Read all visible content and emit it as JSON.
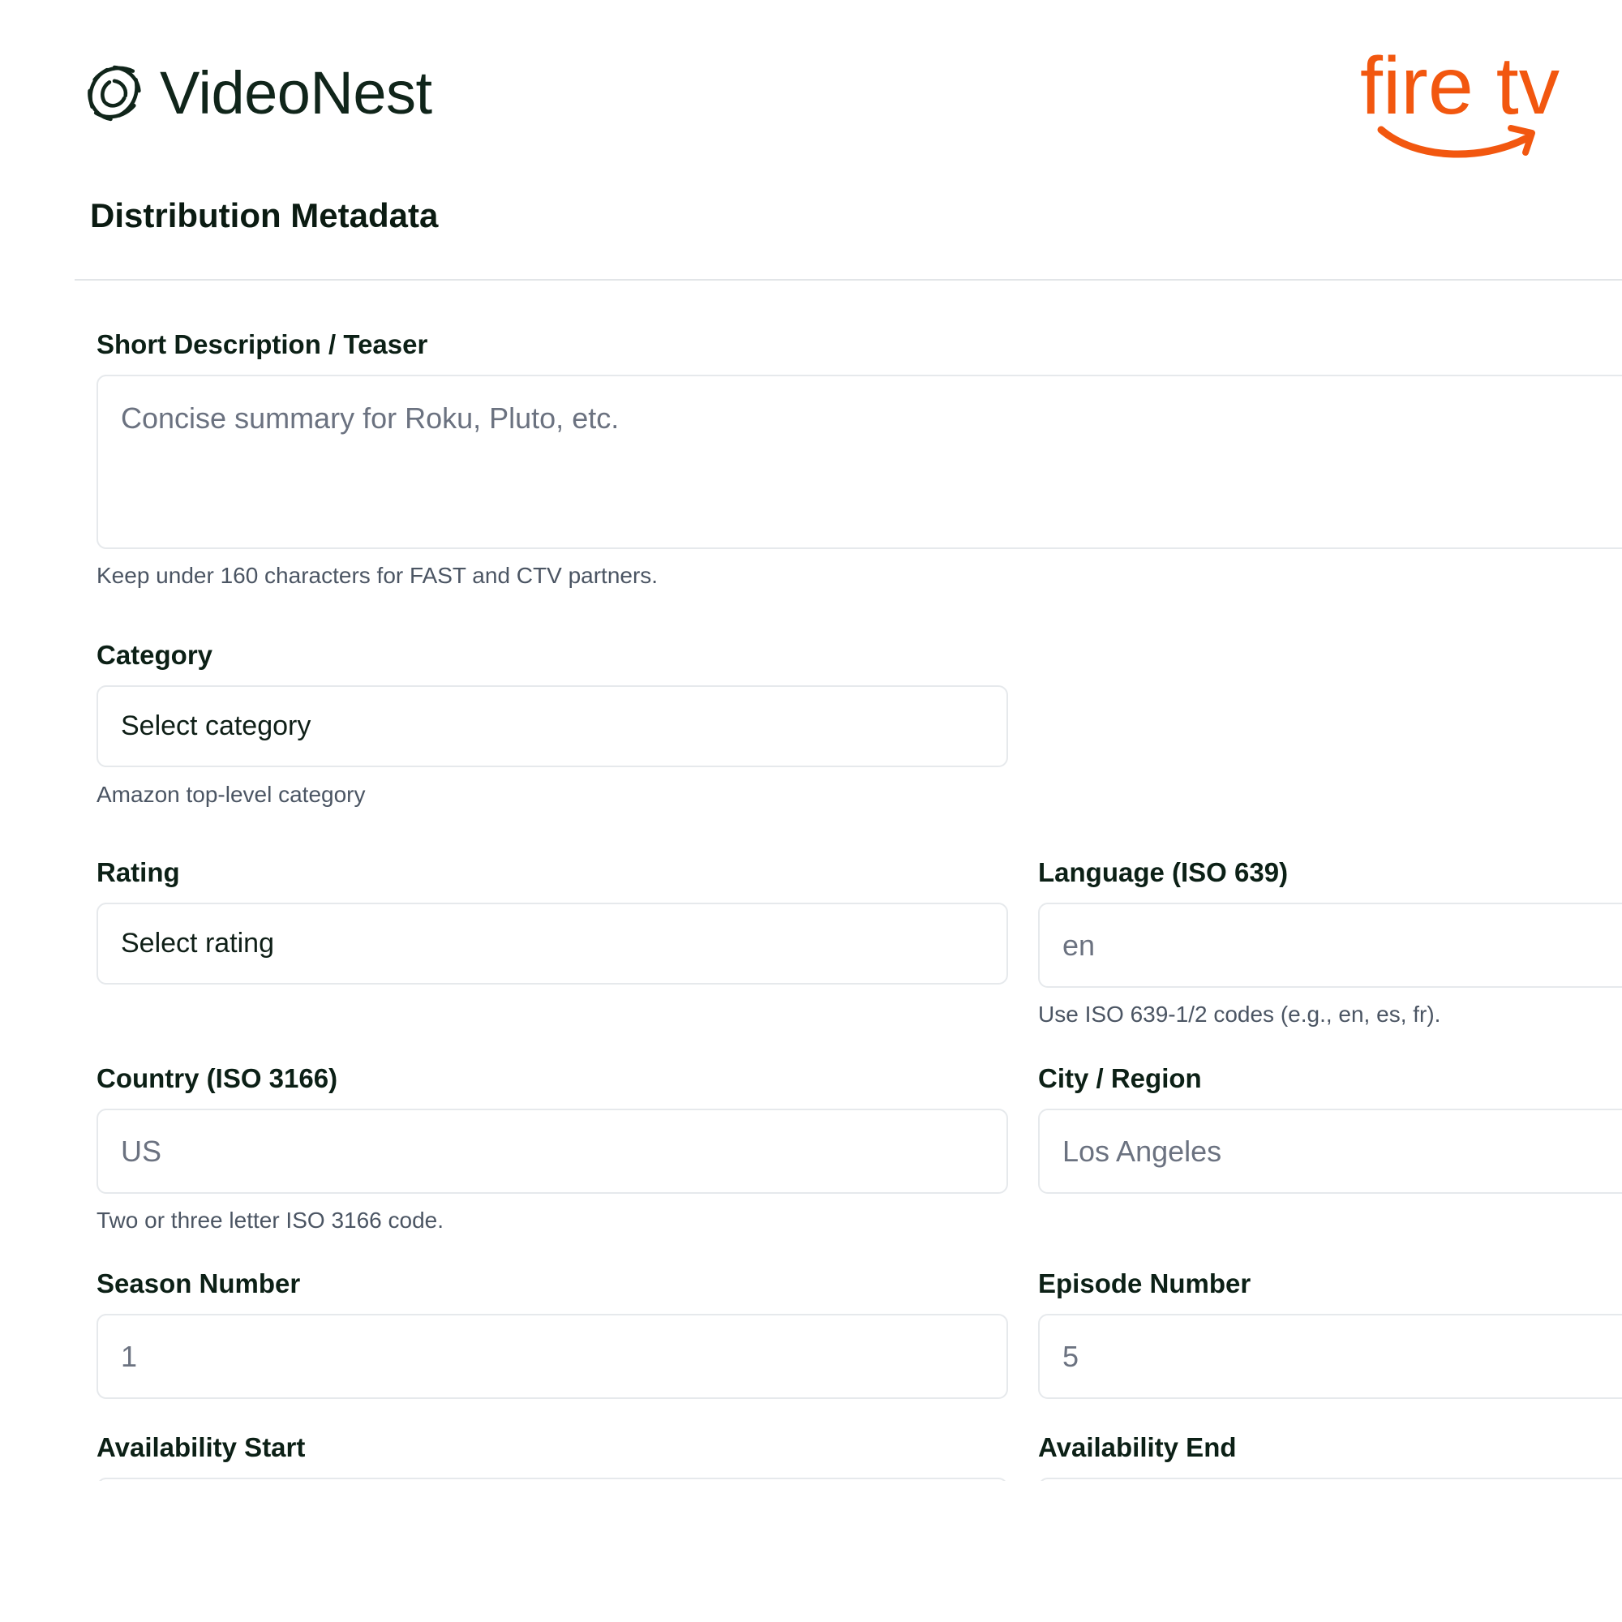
{
  "brand": {
    "name": "VideoNest",
    "logo_icon": "aperture-swirl-icon",
    "color": "#10251a"
  },
  "partner": {
    "logo_text": "fire tv",
    "logo_icon": "fire-tv-smile-logo",
    "color": "#f2570f"
  },
  "page": {
    "title": "Distribution Metadata"
  },
  "form": {
    "short_description": {
      "label": "Short Description / Teaser",
      "placeholder": "Concise summary for Roku, Pluto, etc.",
      "value": "",
      "help": "Keep under 160 characters for FAST and CTV partners."
    },
    "category": {
      "label": "Category",
      "selected": "Select category",
      "help": "Amazon top-level category"
    },
    "rating": {
      "label": "Rating",
      "selected": "Select rating"
    },
    "language": {
      "label": "Language (ISO 639)",
      "placeholder": "en",
      "value": "",
      "help": "Use ISO 639-1/2 codes (e.g., en, es, fr)."
    },
    "country": {
      "label": "Country (ISO 3166)",
      "placeholder": "US",
      "value": "",
      "help": "Two or three letter ISO 3166 code."
    },
    "city_region": {
      "label": "City / Region",
      "placeholder": "Los Angeles",
      "value": ""
    },
    "season_number": {
      "label": "Season Number",
      "placeholder": "1",
      "value": ""
    },
    "episode_number": {
      "label": "Episode Number",
      "placeholder": "5",
      "value": ""
    },
    "availability_start": {
      "label": "Availability Start"
    },
    "availability_end": {
      "label": "Availability End"
    }
  },
  "colors": {
    "text": "#0c2016",
    "help_text": "#4b5563",
    "placeholder": "#6b7280",
    "border": "#e6e9ec"
  }
}
